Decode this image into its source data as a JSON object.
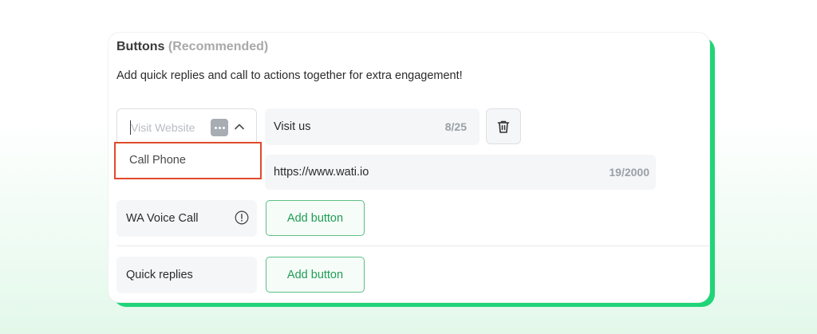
{
  "section": {
    "title": "Buttons",
    "title_suffix": "(Recommended)",
    "description": "Add quick replies and call to actions together for extra engagement!"
  },
  "cta_row": {
    "type_select": {
      "placeholder": "Visit Website",
      "icon": "more-dots-icon",
      "chevron": "chevron-up-icon"
    },
    "dropdown_options": [
      "Call Phone"
    ],
    "button_text": {
      "value": "Visit us",
      "counter": "8/25"
    },
    "url": {
      "value": "https://www.wati.io",
      "counter": "19/2000"
    },
    "delete_icon": "trash-icon"
  },
  "voice_call": {
    "label": "WA Voice Call",
    "icon": "info-icon",
    "add_button": "Add button"
  },
  "quick_replies": {
    "label": "Quick replies",
    "add_button": "Add button"
  },
  "colors": {
    "accent_green": "#20d478",
    "button_green": "#1f9d55",
    "highlight_red": "#e04a2a"
  }
}
